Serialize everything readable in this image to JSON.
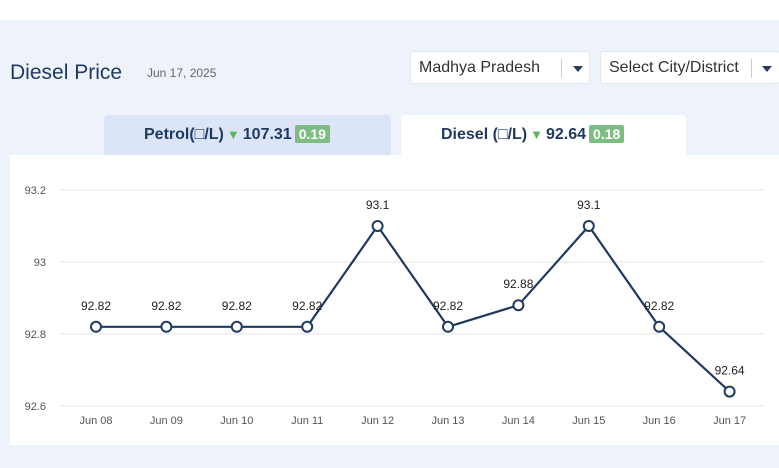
{
  "header": {
    "title": "Diesel Price",
    "date": "Jun 17, 2025"
  },
  "selects": {
    "state": "Madhya Pradesh",
    "city": "Select City/District"
  },
  "tabs": {
    "petrol": {
      "label": "Petrol(□/L)",
      "price": "107.31",
      "change": "0.19",
      "direction": "down"
    },
    "diesel": {
      "label": "Diesel (□/L)",
      "price": "92.64",
      "change": "0.18",
      "direction": "down"
    }
  },
  "colors": {
    "line": "#1f3a5f",
    "badge": "#7dbd83",
    "arrow": "#5cb85c"
  },
  "chart_data": {
    "type": "line",
    "categories": [
      "Jun 08",
      "Jun 09",
      "Jun 10",
      "Jun 11",
      "Jun 12",
      "Jun 13",
      "Jun 14",
      "Jun 15",
      "Jun 16",
      "Jun 17"
    ],
    "series": [
      {
        "values": [
          92.82,
          92.82,
          92.82,
          92.82,
          93.1,
          92.82,
          92.88,
          93.1,
          92.82,
          92.64
        ]
      }
    ],
    "data_labels": [
      "92.82",
      "92.82",
      "92.82",
      "92.82",
      "93.1",
      "92.82",
      "92.88",
      "93.1",
      "92.82",
      "92.64"
    ],
    "yticks": [
      "92.6",
      "92.8",
      "93",
      "93.2"
    ],
    "ylim": [
      92.6,
      93.2
    ],
    "grid": true
  }
}
